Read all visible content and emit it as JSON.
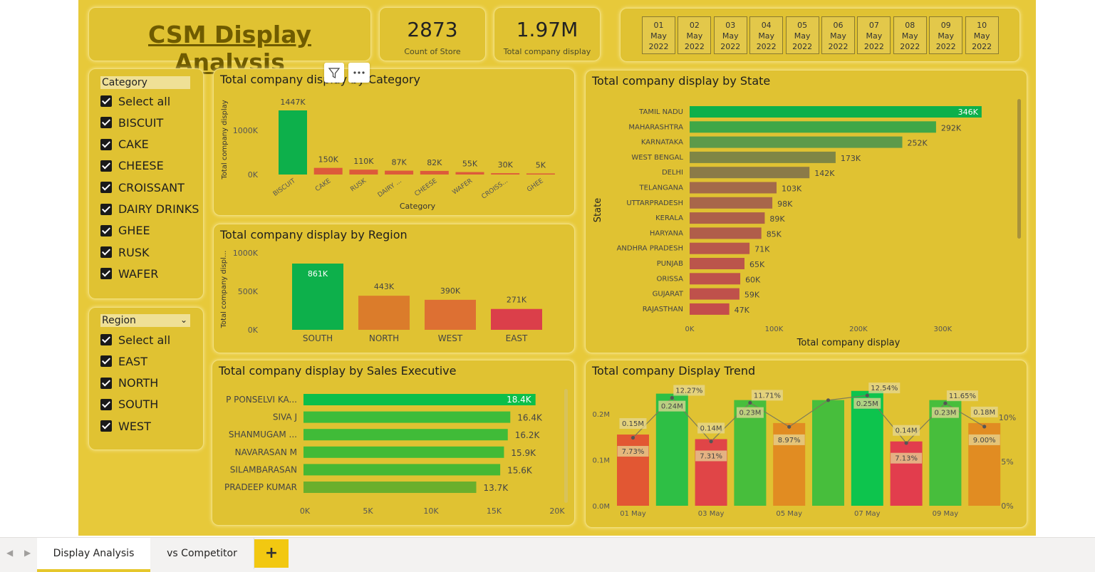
{
  "report": {
    "title": "CSM Display Analysis",
    "kpis": [
      {
        "value": "2873",
        "label": "Count of Store"
      },
      {
        "value": "1.97M",
        "label": "Total company display"
      }
    ],
    "dates": [
      {
        "day": "01",
        "month": "May",
        "year": "2022"
      },
      {
        "day": "02",
        "month": "May",
        "year": "2022"
      },
      {
        "day": "03",
        "month": "May",
        "year": "2022"
      },
      {
        "day": "04",
        "month": "May",
        "year": "2022"
      },
      {
        "day": "05",
        "month": "May",
        "year": "2022"
      },
      {
        "day": "06",
        "month": "May",
        "year": "2022"
      },
      {
        "day": "07",
        "month": "May",
        "year": "2022"
      },
      {
        "day": "08",
        "month": "May",
        "year": "2022"
      },
      {
        "day": "09",
        "month": "May",
        "year": "2022"
      },
      {
        "day": "10",
        "month": "May",
        "year": "2022"
      }
    ]
  },
  "category_slicer": {
    "header": "Category",
    "items": [
      "Select all",
      "BISCUIT",
      "CAKE",
      "CHEESE",
      "CROISSANT",
      "DAIRY DRINKS",
      "GHEE",
      "RUSK",
      "WAFER"
    ]
  },
  "region_slicer": {
    "header": "Region",
    "items": [
      "Select all",
      "EAST",
      "NORTH",
      "SOUTH",
      "WEST"
    ]
  },
  "colors": {
    "canvas": "#e7c93a",
    "green": "#0db04b",
    "red": "#d9453f",
    "orange": "#db7c2b"
  },
  "chart_data": [
    {
      "id": "category",
      "type": "bar",
      "title": "Total company display by Category",
      "xlabel": "Category",
      "ylabel": "Total company display",
      "yticks": [
        "0K",
        "1000K"
      ],
      "ylim": [
        0,
        1447
      ],
      "categories": [
        "BISCUIT",
        "CAKE",
        "RUSK",
        "DAIRY ...",
        "CHEESE",
        "WAFER",
        "CROISS...",
        "GHEE"
      ],
      "values": [
        1447,
        150,
        110,
        87,
        82,
        55,
        30,
        5
      ],
      "labels": [
        "1447K",
        "150K",
        "110K",
        "87K",
        "82K",
        "55K",
        "30K",
        "5K"
      ],
      "colors": [
        "#0db04b",
        "#dd5a3a",
        "#dd5a3a",
        "#dd5a3a",
        "#dd5a3a",
        "#dd5a3a",
        "#dd5a3a",
        "#dd5a3a"
      ]
    },
    {
      "id": "region",
      "type": "bar",
      "title": "Total company display by Region",
      "ylabel": "Total company displ...",
      "yticks": [
        "0K",
        "500K",
        "1000K"
      ],
      "ylim": [
        0,
        1000
      ],
      "categories": [
        "SOUTH",
        "NORTH",
        "WEST",
        "EAST"
      ],
      "values": [
        861,
        443,
        390,
        271
      ],
      "labels": [
        "861K",
        "443K",
        "390K",
        "271K"
      ],
      "colors": [
        "#0db04b",
        "#db7c2b",
        "#dd7033",
        "#db3f4a"
      ]
    },
    {
      "id": "state",
      "type": "bar",
      "title": "Total company display by State",
      "xlabel": "Total company display",
      "ylabel": "State",
      "xticks": [
        "0K",
        "100K",
        "200K",
        "300K"
      ],
      "xlim": [
        0,
        350
      ],
      "categories": [
        "TAMIL NADU",
        "MAHARASHTRA",
        "KARNATAKA",
        "WEST BENGAL",
        "DELHI",
        "TELANGANA",
        "UTTARPRADESH",
        "KERALA",
        "HARYANA",
        "ANDHRA PRADESH",
        "PUNJAB",
        "ORISSA",
        "GUJARAT",
        "RAJASTHAN"
      ],
      "values": [
        346,
        292,
        252,
        173,
        142,
        103,
        98,
        89,
        85,
        71,
        65,
        60,
        59,
        47
      ],
      "labels": [
        "346K",
        "292K",
        "252K",
        "173K",
        "142K",
        "103K",
        "98K",
        "89K",
        "85K",
        "71K",
        "65K",
        "60K",
        "59K",
        "47K"
      ],
      "colors": [
        "#0db04b",
        "#3fa747",
        "#5d9a4a",
        "#7f8645",
        "#8b7a48",
        "#a36a4a",
        "#a8664a",
        "#ad604a",
        "#b05d4a",
        "#b8584b",
        "#bb554b",
        "#be524b",
        "#bf514b",
        "#c44c4b"
      ]
    },
    {
      "id": "sales_exec",
      "type": "bar",
      "title": "Total company display by Sales Executive",
      "xticks": [
        "0K",
        "5K",
        "10K",
        "15K",
        "20K"
      ],
      "xlim": [
        0,
        20
      ],
      "categories": [
        "P PONSELVI KA...",
        "SIVA J",
        "SHANMUGAM ...",
        "NAVARASAN M",
        "SILAMBARASAN",
        "PRADEEP KUMAR"
      ],
      "values": [
        18.4,
        16.4,
        16.2,
        15.9,
        15.6,
        13.7
      ],
      "labels": [
        "18.4K",
        "16.4K",
        "16.2K",
        "15.9K",
        "15.6K",
        "13.7K"
      ],
      "colors": [
        "#0bbf4a",
        "#3ebc3a",
        "#40bb38",
        "#42ba36",
        "#46b834",
        "#6aaf2c"
      ]
    },
    {
      "id": "trend",
      "type": "bar",
      "title": "Total company Display Trend",
      "x": [
        "01 May",
        "02 May",
        "03 May",
        "04 May",
        "05 May",
        "06 May",
        "07 May",
        "08 May",
        "09 May",
        "10 May"
      ],
      "xticks": [
        "01 May",
        "03 May",
        "05 May",
        "07 May",
        "09 May"
      ],
      "yticks_left": [
        "0.0M",
        "0.1M",
        "0.2M"
      ],
      "yticks_right": [
        "0%",
        "5%",
        "10%"
      ],
      "ylim": [
        0,
        0.3
      ],
      "values": [
        0.155,
        0.244,
        0.145,
        0.23,
        0.18,
        0.23,
        0.25,
        0.14,
        0.23,
        0.18
      ],
      "line_pct": [
        7.73,
        12.27,
        7.31,
        11.71,
        8.97,
        12.0,
        12.54,
        7.13,
        11.65,
        9.0
      ],
      "value_labels": [
        "0.15M",
        "0.24M",
        "0.14M",
        "0.23M",
        "",
        "",
        "0.25M",
        "0.14M",
        "0.23M",
        "0.18M"
      ],
      "pct_labels": [
        "7.73%",
        "12.27%",
        "7.31%",
        "11.71%",
        "8.97%",
        "",
        "12.54%",
        "7.13%",
        "11.65%",
        "9.00%"
      ],
      "colors": [
        "#e25733",
        "#2ebf45",
        "#e04547",
        "#47be3c",
        "#e18c22",
        "#47be3c",
        "#0dc44d",
        "#e23d4d",
        "#47be3c",
        "#e18c22"
      ]
    }
  ],
  "tabs": [
    {
      "label": "Display Analysis",
      "active": true
    },
    {
      "label": "vs Competitor",
      "active": false
    }
  ],
  "add_tab": "+"
}
